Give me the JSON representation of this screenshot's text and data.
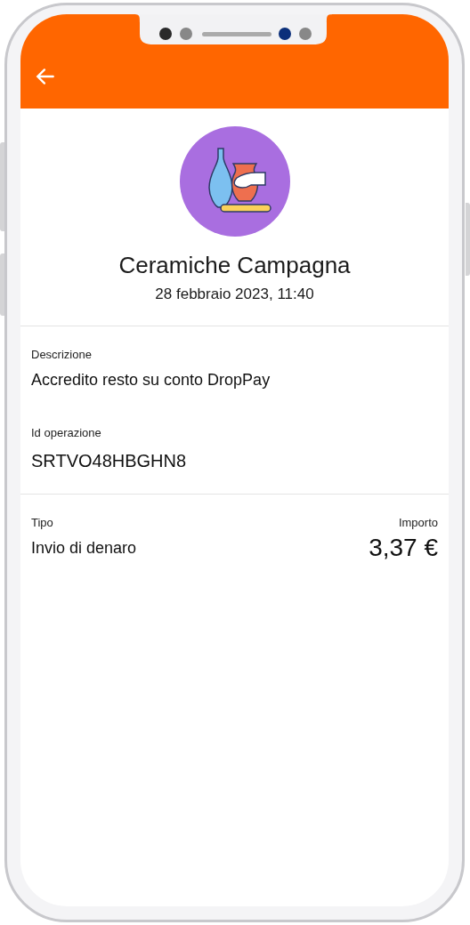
{
  "merchant": {
    "name": "Ceramiche Campagna",
    "date": "28 febbraio 2023, 11:40"
  },
  "details": [
    {
      "label": "Descrizione",
      "value": "Accredito resto su conto DropPay"
    },
    {
      "label": "Id operazione",
      "value": "SRTVO48HBGHN8"
    }
  ],
  "summary": {
    "type_label": "Tipo",
    "type_value": "Invio di denaro",
    "amount_label": "Importo",
    "amount_value": "3,37 €"
  }
}
